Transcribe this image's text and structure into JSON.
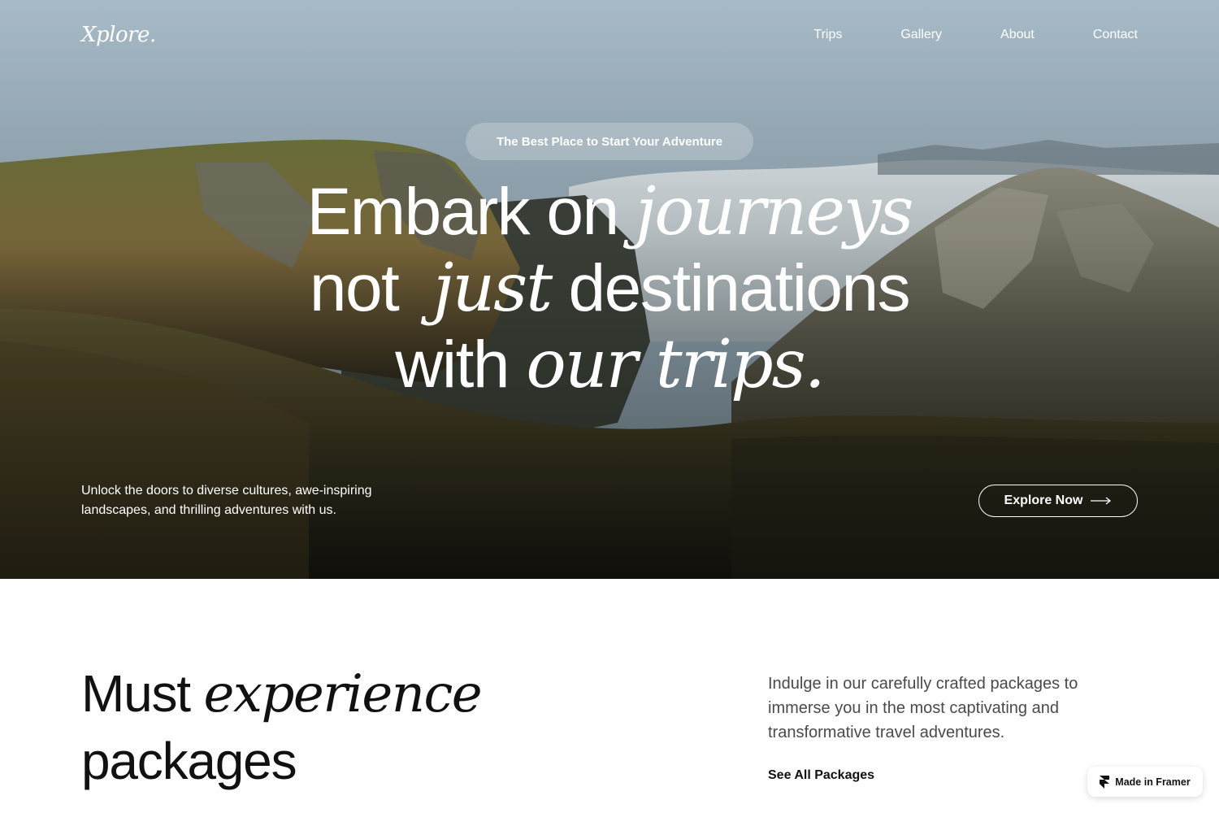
{
  "nav": {
    "logo": "Xplore.",
    "links": [
      "Trips",
      "Gallery",
      "About",
      "Contact"
    ]
  },
  "hero": {
    "badge": "The Best Place to Start Your Adventure",
    "headline": {
      "line1_plain": "Embark on",
      "line1_italic": "journeys",
      "line2_plain_a": "not",
      "line2_italic": "just",
      "line2_plain_b": "destinations",
      "line3_plain": "with",
      "line3_italic": "our trips."
    },
    "description": "Unlock the doors to diverse cultures, awe-inspiring landscapes, and thrilling adventures with us.",
    "cta_label": "Explore Now",
    "cta_icon": "arrow-right-icon"
  },
  "packages": {
    "title_plain_a": "Must",
    "title_italic": "experience",
    "title_plain_b": "packages",
    "description": "Indulge in our carefully crafted packages to immerse you in the most captivating and transformative travel adventures.",
    "link_label": "See All Packages"
  },
  "badge": {
    "label": "Made in Framer",
    "icon": "framer-logo-icon"
  },
  "colors": {
    "text_dark": "#111111",
    "text_muted": "#4a4a4a",
    "hero_text": "#ffffff"
  }
}
